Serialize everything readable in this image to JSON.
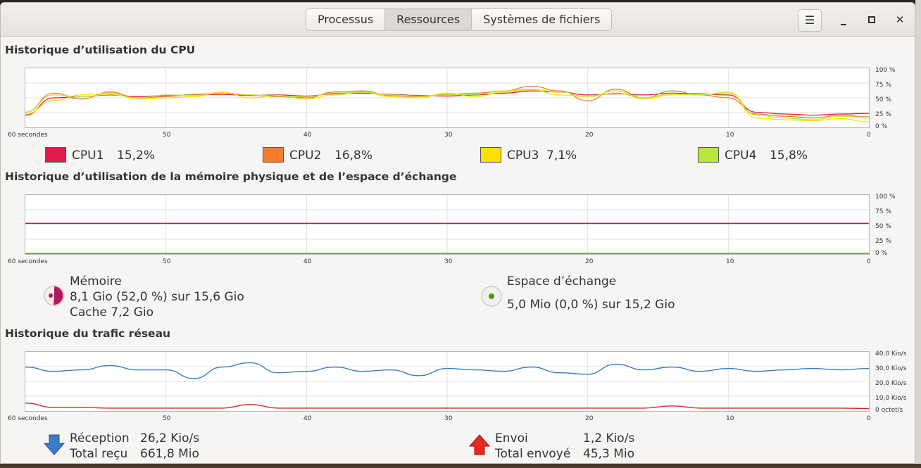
{
  "tabs": [
    {
      "label": "Processus",
      "active": false
    },
    {
      "label": "Ressources",
      "active": true
    },
    {
      "label": "Systèmes de fichiers",
      "active": false
    }
  ],
  "window_controls": {
    "menu": "hamburger-icon",
    "minimize": "minimize-icon",
    "maximize": "maximize-icon",
    "close": "close-icon"
  },
  "cpu": {
    "title": "Historique d’utilisation du CPU",
    "y_ticks": [
      "100 %",
      "75 %",
      "50 %",
      "25 %",
      "0 %"
    ],
    "x_ticks": [
      "60 secondes",
      "50",
      "40",
      "30",
      "20",
      "10",
      "0"
    ],
    "legend": [
      {
        "name": "CPU1",
        "value": "15,2%",
        "color": "#e01b4c"
      },
      {
        "name": "CPU2",
        "value": "16,8%",
        "color": "#f57c2e"
      },
      {
        "name": "CPU3",
        "value": "7,1%",
        "color": "#fbe100"
      },
      {
        "name": "CPU4",
        "value": "15,8%",
        "color": "#b9e83b"
      }
    ]
  },
  "memory": {
    "title": "Historique d’utilisation de la mémoire physique et de l’espace d’échange",
    "y_ticks": [
      "100 %",
      "75 %",
      "50 %",
      "25 %",
      "0 %"
    ],
    "x_ticks": [
      "60 secondes",
      "50",
      "40",
      "30",
      "20",
      "10",
      "0"
    ],
    "mem_label": "Mémoire",
    "mem_usage": "8,1 Gio (52,0 %) sur 15,6 Gio",
    "mem_cache": "Cache 7,2 Gio",
    "mem_color": "#b2195a",
    "swap_label": "Espace d’échange",
    "swap_usage": "5,0 Mio (0,0 %) sur 15,2 Gio",
    "swap_color": "#4e9a06"
  },
  "network": {
    "title": "Historique du trafic réseau",
    "y_ticks": [
      "40,0 Kio/s",
      "30,0 Kio/s",
      "20,0 Kio/s",
      "10,0 Kio/s",
      "0 octet/s"
    ],
    "x_ticks": [
      "60 secondes",
      "50",
      "40",
      "30",
      "20",
      "10",
      "0"
    ],
    "rx_label": "Réception",
    "rx_value": "26,2 Kio/s",
    "rx_total_label": "Total reçu",
    "rx_total_value": "661,8 Mio",
    "rx_color": "#3a7dc5",
    "tx_label": "Envoi",
    "tx_value": "1,2 Kio/s",
    "tx_total_label": "Total envoyé",
    "tx_total_value": "45,3 Mio",
    "tx_color": "#d8261c"
  },
  "chart_data": [
    {
      "type": "line",
      "x": [
        60,
        58,
        56,
        54,
        52,
        50,
        48,
        46,
        44,
        42,
        40,
        38,
        36,
        34,
        32,
        30,
        28,
        26,
        24,
        22,
        20,
        18,
        16,
        14,
        12,
        10,
        8,
        6,
        4,
        2,
        0
      ],
      "ylim": [
        0,
        100
      ],
      "series": [
        {
          "name": "CPU1",
          "values": [
            20,
            50,
            52,
            55,
            52,
            54,
            55,
            56,
            54,
            55,
            53,
            57,
            58,
            56,
            54,
            53,
            55,
            58,
            62,
            60,
            55,
            57,
            55,
            58,
            57,
            55,
            25,
            22,
            20,
            22,
            23
          ]
        },
        {
          "name": "CPU2",
          "values": [
            25,
            58,
            48,
            60,
            50,
            52,
            56,
            58,
            55,
            52,
            50,
            60,
            62,
            54,
            52,
            56,
            58,
            62,
            70,
            62,
            45,
            65,
            50,
            62,
            55,
            50,
            22,
            18,
            15,
            20,
            17
          ]
        },
        {
          "name": "CPU3",
          "values": [
            22,
            45,
            55,
            58,
            48,
            50,
            52,
            60,
            50,
            54,
            48,
            55,
            60,
            52,
            50,
            58,
            52,
            60,
            64,
            55,
            52,
            62,
            48,
            55,
            56,
            58,
            15,
            12,
            10,
            14,
            8
          ]
        },
        {
          "name": "CPU4",
          "values": [
            25,
            55,
            52,
            56,
            50,
            55,
            54,
            58,
            55,
            53,
            52,
            58,
            60,
            55,
            53,
            55,
            56,
            62,
            65,
            60,
            52,
            58,
            50,
            57,
            55,
            60,
            20,
            15,
            12,
            18,
            16
          ]
        }
      ]
    },
    {
      "type": "line",
      "x": [
        60,
        0
      ],
      "ylim": [
        0,
        100
      ],
      "series": [
        {
          "name": "Mémoire",
          "values": [
            52,
            52
          ]
        },
        {
          "name": "Espace d’échange",
          "values": [
            0,
            0
          ]
        }
      ]
    },
    {
      "type": "line",
      "x": [
        60,
        58,
        56,
        54,
        52,
        50,
        48,
        46,
        44,
        42,
        40,
        38,
        36,
        34,
        32,
        30,
        28,
        26,
        24,
        22,
        20,
        18,
        16,
        14,
        12,
        10,
        8,
        6,
        4,
        2,
        0
      ],
      "ylim": [
        0,
        40
      ],
      "series": [
        {
          "name": "Réception",
          "values": [
            30,
            27,
            28,
            31,
            28,
            28,
            22,
            30,
            33,
            26,
            27,
            30,
            27,
            28,
            24,
            29,
            28,
            27,
            30,
            26,
            25,
            32,
            28,
            30,
            27,
            29,
            27,
            28,
            29,
            28,
            29
          ]
        },
        {
          "name": "Envoi",
          "values": [
            5,
            2,
            2,
            1.5,
            1.5,
            1.5,
            1.5,
            1.5,
            4,
            1.5,
            1.5,
            1.5,
            1.5,
            1.5,
            1.5,
            1.5,
            1.5,
            1.5,
            1.5,
            1.5,
            1.5,
            1.5,
            1.5,
            3,
            1.5,
            1.5,
            1.5,
            1.5,
            1.5,
            1.5,
            1.2
          ]
        }
      ]
    }
  ]
}
